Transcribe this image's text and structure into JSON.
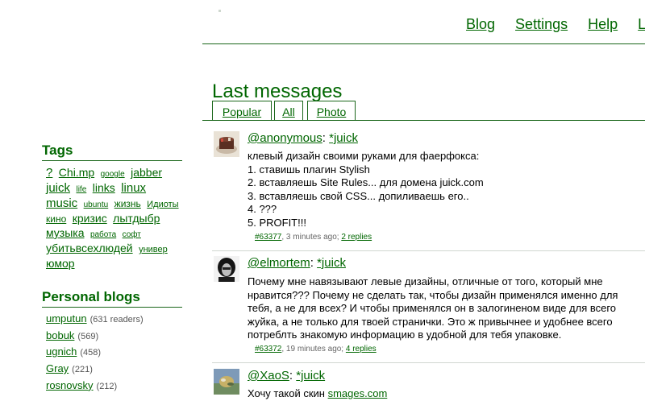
{
  "header": {
    "nav": [
      "Blog",
      "Settings",
      "Help",
      "Lo"
    ]
  },
  "page_title": "Last messages",
  "tabs": [
    "Popular",
    "All",
    "Photo"
  ],
  "sidebar": {
    "tags_title": "Tags",
    "tags": [
      {
        "label": "?",
        "size": "t5"
      },
      {
        "label": "Chi.mp",
        "size": "t4"
      },
      {
        "label": "google",
        "size": "t1"
      },
      {
        "label": "jabber",
        "size": "t4"
      },
      {
        "label": "juick",
        "size": "t5"
      },
      {
        "label": "life",
        "size": "t1"
      },
      {
        "label": "links",
        "size": "t4"
      },
      {
        "label": "linux",
        "size": "t5"
      },
      {
        "label": "music",
        "size": "t5"
      },
      {
        "label": "ubuntu",
        "size": "t1"
      },
      {
        "label": "жизнь",
        "size": "t3"
      },
      {
        "label": "Идиоты",
        "size": "t2"
      },
      {
        "label": "кино",
        "size": "t3"
      },
      {
        "label": "кризис",
        "size": "t4"
      },
      {
        "label": "лытдыбр",
        "size": "t4"
      },
      {
        "label": "музыка",
        "size": "t4"
      },
      {
        "label": "работа",
        "size": "t1"
      },
      {
        "label": "софт",
        "size": "t1"
      },
      {
        "label": "убитьвсехлюдей",
        "size": "t4"
      },
      {
        "label": "универ",
        "size": "t2"
      },
      {
        "label": "юмор",
        "size": "t4"
      }
    ],
    "blogs_title": "Personal blogs",
    "blogs": [
      {
        "name": "umputun",
        "count": "(631 readers)"
      },
      {
        "name": "bobuk",
        "count": "(569)"
      },
      {
        "name": "ugnich",
        "count": "(458)"
      },
      {
        "name": "Gray",
        "count": "(221)"
      },
      {
        "name": "rosnovsky",
        "count": "(212)"
      }
    ]
  },
  "messages": [
    {
      "user": "@anonymous",
      "tag": "*juick",
      "lines": [
        "клевый дизайн своими руками для фаерфокса:",
        "1. ставишь плагин Stylish",
        "2. вставляешь Site Rules... для домена juick.com",
        "3. вставляешь свой CSS... допиливаешь его..",
        "4. ???",
        "5. PROFIT!!!"
      ],
      "id": "#63377",
      "time": ", 3 minutes ago; ",
      "replies": "2 replies"
    },
    {
      "user": "@elmortem",
      "tag": "*juick",
      "lines": [
        "Почему мне навязывают левые дизайны, отличные от того, который мне",
        "нравится??? Почему не сделать так, чтобы дизайн применялся именно для",
        "тебя, а не для всех? И чтобы применялся он в залогиненом виде для всего",
        "жуйка, а не только для твоей странички. Это ж привычнее и удобнее всего",
        "потреблть знакомую информацию в удобной для тебя упаковке."
      ],
      "id": "#63372",
      "time": ", 19 minutes ago; ",
      "replies": "4 replies"
    },
    {
      "user": "@XaoS",
      "tag": "*juick",
      "text_prefix": "Хочу такой скин ",
      "text_link": "smages.com"
    }
  ]
}
